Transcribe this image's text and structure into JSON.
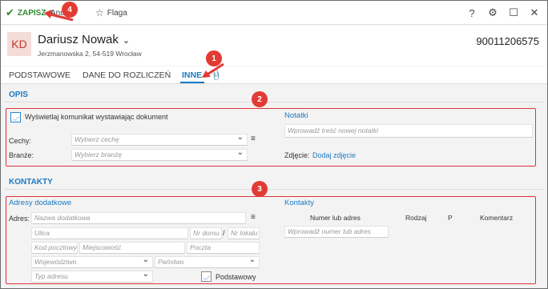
{
  "toolbar": {
    "save_label": "ZAPISZ",
    "cancel_label": "Anuluj",
    "flag_label": "Flaga",
    "help_icon": "?",
    "settings_icon": "⚙",
    "maximize_icon": "☐",
    "close_icon": "✕"
  },
  "header": {
    "avatar_initials": "KD",
    "name": "Dariusz Nowak",
    "address": "Jerzmanowska 2, 54-519 Wrocław",
    "identifier": "90011206575"
  },
  "tabs": [
    {
      "label": "PODSTAWOWE"
    },
    {
      "label": "DANE DO ROZLICZEŃ"
    },
    {
      "label": "INNE"
    }
  ],
  "opis": {
    "title": "OPIS",
    "show_message_label": "Wyświetlaj komunikat wystawiając dokument",
    "cechy_label": "Cechy:",
    "cechy_placeholder": "Wybierz cechę",
    "branze_label": "Branże:",
    "branze_placeholder": "Wybierz branżę",
    "notes_title": "Notatki",
    "notes_placeholder": "Wprowadź treść nowej notatki",
    "photo_label": "Zdjęcie:",
    "photo_link": "Dodaj zdjęcie"
  },
  "kontakty": {
    "title": "KONTAKTY",
    "addresses_title": "Adresy dodatkowe",
    "adres_label": "Adres:",
    "name_placeholder": "Nazwa dodatkowa",
    "street_placeholder": "Ulica",
    "house_placeholder": "Nr domu",
    "separator": "/",
    "flat_placeholder": "Nr lokalu",
    "postcode_placeholder": "Kod pocztowy",
    "city_placeholder": "Miejscowość",
    "post_placeholder": "Poczta",
    "voivodeship_placeholder": "Województwo",
    "country_placeholder": "Państwo",
    "address_type_placeholder": "Typ adresu",
    "primary_label": "Podstawowy",
    "contacts_title": "Kontakty",
    "columns": [
      "Numer lub adres",
      "Rodzaj",
      "P",
      "Komentarz"
    ],
    "number_placeholder": "Wprowadź numer lub adres"
  },
  "annotations": [
    "1",
    "2",
    "3",
    "4"
  ],
  "colors": {
    "accent": "#1a7ac4",
    "save_green": "#2f8a2f",
    "annotation_red": "#e23b34"
  }
}
